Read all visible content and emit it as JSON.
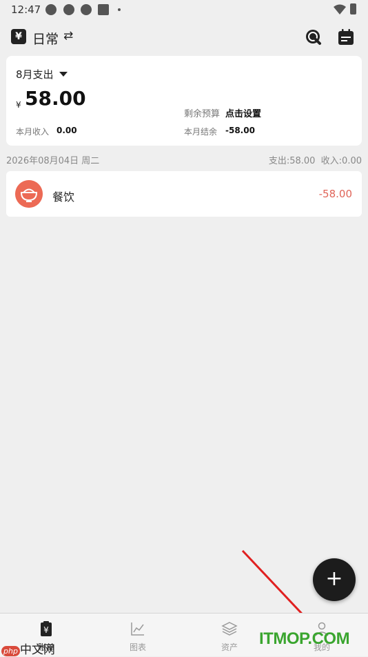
{
  "status_bar": {
    "time": "12:47"
  },
  "app_bar": {
    "book_name": "日常",
    "switch_symbol": "⇄",
    "book_icon_glyph": "¥"
  },
  "summary": {
    "month_label": "8月支出",
    "currency": "¥",
    "expense_total": "58.00",
    "budget_label": "剩余预算",
    "budget_value": "点击设置",
    "income_label": "本月收入",
    "income_value": "0.00",
    "balance_label": "本月结余",
    "balance_value": "-58.00"
  },
  "day_group": {
    "date": "2026年08月04日 周二",
    "totals": "支出:58.00  收入:0.00"
  },
  "transactions": [
    {
      "category": "餐饮",
      "amount": "-58.00",
      "icon": "rice-bowl-icon",
      "icon_color": "#ec6a55"
    }
  ],
  "fab": {
    "symbol": "+"
  },
  "bottom_nav": [
    {
      "label": "账单",
      "icon": "bill-icon",
      "active": true
    },
    {
      "label": "图表",
      "icon": "chart-icon",
      "active": false
    },
    {
      "label": "资产",
      "icon": "layers-icon",
      "active": false
    },
    {
      "label": "我的",
      "icon": "person-icon",
      "active": false
    }
  ],
  "watermarks": {
    "itmop": "ITMOP.COM",
    "php_badge": "php",
    "php_text": "中文网"
  },
  "colors": {
    "accent": "#1c1c1c",
    "expense_red": "#e06458",
    "food_icon": "#ec6a55",
    "itmop_green": "#3aa52f"
  }
}
